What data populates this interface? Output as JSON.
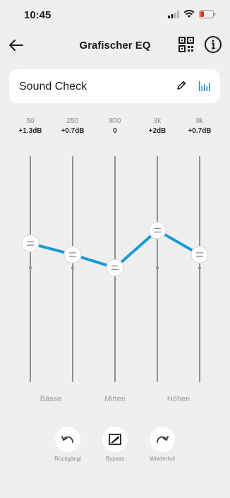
{
  "status_bar": {
    "time": "10:45"
  },
  "header": {
    "title": "Grafischer EQ"
  },
  "preset": {
    "name": "Sound Check"
  },
  "bands": [
    {
      "freq": "50",
      "gain": "+1.3dB",
      "gain_db": 1.3
    },
    {
      "freq": "250",
      "gain": "+0.7dB",
      "gain_db": 0.7
    },
    {
      "freq": "800",
      "gain": "0",
      "gain_db": 0
    },
    {
      "freq": "3k",
      "gain": "+2dB",
      "gain_db": 2
    },
    {
      "freq": "8k",
      "gain": "+0.7dB",
      "gain_db": 0.7
    }
  ],
  "groups": {
    "bass": "Bässe",
    "mid": "Mitten",
    "high": "Höhen"
  },
  "controls": {
    "undo": "Rückgängi",
    "bypass": "Bypass",
    "redo": "Wiederhol"
  },
  "colors": {
    "accent": "#1a9bd6",
    "track": "#8f8f8f",
    "background": "#efefef"
  }
}
